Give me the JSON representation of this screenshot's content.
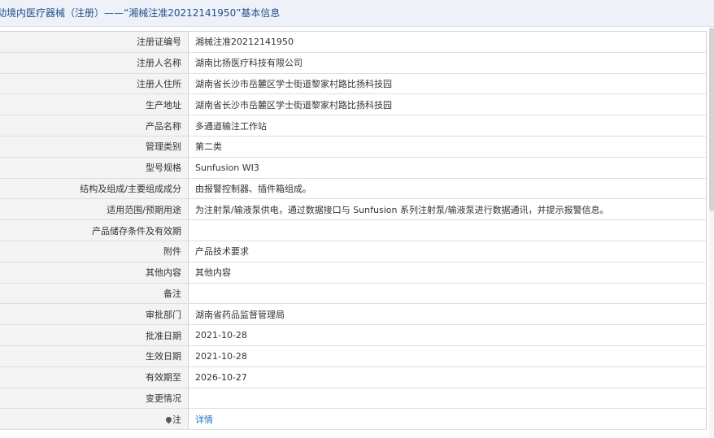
{
  "header": {
    "title": "动境内医疗器械（注册）——“湘械注准20212141950”基本信息"
  },
  "rows": [
    {
      "label": "注册证编号",
      "value": "湘械注准20212141950"
    },
    {
      "label": "注册人名称",
      "value": "湖南比扬医疗科技有限公司"
    },
    {
      "label": "注册人住所",
      "value": "湖南省长沙市岳麓区学士街道黎家村路比扬科技园"
    },
    {
      "label": "生产地址",
      "value": "湖南省长沙市岳麓区学士街道黎家村路比扬科技园"
    },
    {
      "label": "产品名称",
      "value": "多通道输注工作站"
    },
    {
      "label": "管理类别",
      "value": "第二类"
    },
    {
      "label": "型号规格",
      "value": "Sunfusion WI3"
    },
    {
      "label": "结构及组成/主要组成成分",
      "value": "由报警控制器、插件箱组成。"
    },
    {
      "label": "适用范围/预期用途",
      "value": "为注射泵/输液泵供电，通过数据接口与 Sunfusion 系列注射泵/输液泵进行数据通讯，并提示报警信息。"
    },
    {
      "label": "产品储存条件及有效期",
      "value": ""
    },
    {
      "label": "附件",
      "value": "产品技术要求"
    },
    {
      "label": "其他内容",
      "value": "其他内容"
    },
    {
      "label": "备注",
      "value": ""
    },
    {
      "label": "审批部门",
      "value": "湖南省药品监督管理局"
    },
    {
      "label": "批准日期",
      "value": "2021-10-28"
    },
    {
      "label": "生效日期",
      "value": "2021-10-28"
    },
    {
      "label": "有效期至",
      "value": "2026-10-27"
    },
    {
      "label": "变更情况",
      "value": ""
    },
    {
      "label": "注",
      "value": "详情"
    }
  ],
  "icons": {
    "note_marker": "map-pin-icon"
  }
}
